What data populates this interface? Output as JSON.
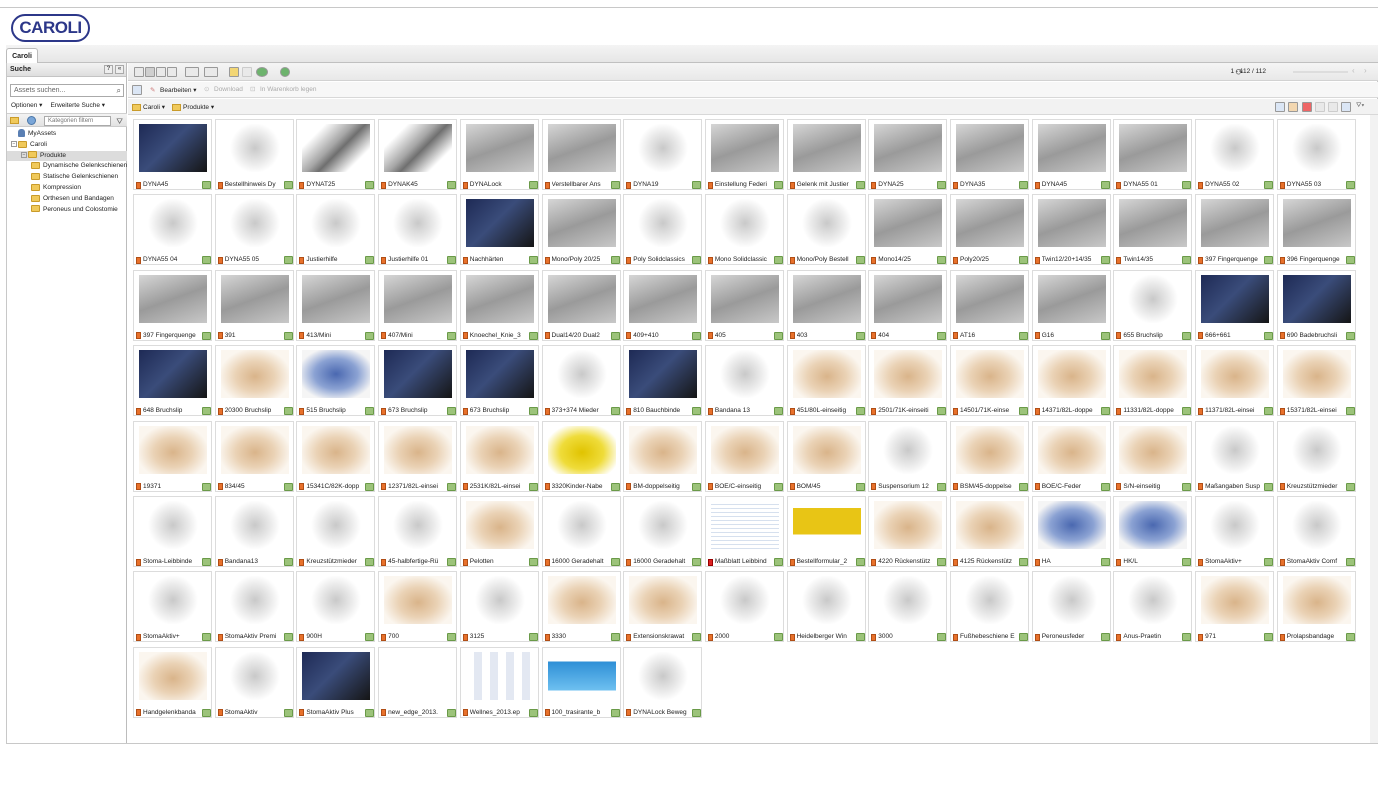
{
  "brand": {
    "logo_text": "CAROLI"
  },
  "tabs": [
    {
      "label": "Caroli"
    }
  ],
  "left_panel": {
    "title": "Suche",
    "help_btn": "?",
    "collapse_btn": "«",
    "search_placeholder": "Assets suchen...",
    "options_label": "Optionen ▾",
    "advanced_label": "Erweiterte Suche ▾",
    "category_filter_placeholder": "Kategorien filtern",
    "tree": [
      {
        "label": "MyAssets",
        "level": 0,
        "icon": "user-icon"
      },
      {
        "label": "Caroli",
        "level": 0,
        "icon": "folder-icon"
      },
      {
        "label": "Produkte",
        "level": 1,
        "icon": "folder-icon",
        "selected": true
      },
      {
        "label": "Dynamische Gelenkschienen",
        "level": 2,
        "icon": "folder-icon"
      },
      {
        "label": "Statische Gelenkschienen",
        "level": 2,
        "icon": "folder-icon"
      },
      {
        "label": "Kompression",
        "level": 2,
        "icon": "folder-icon"
      },
      {
        "label": "Orthesen und Bandagen",
        "level": 2,
        "icon": "folder-icon"
      },
      {
        "label": "Peroneus und Colostomie",
        "level": 2,
        "icon": "folder-icon"
      }
    ]
  },
  "toolbar": {
    "pagination": "1 - 112 / 112",
    "edit_label": "Bearbeiten ▾",
    "download_label": "Download",
    "basket_label": "In Warenkorb legen"
  },
  "breadcrumb": [
    {
      "label": "Caroli ▾"
    },
    {
      "label": "Produkte ▾"
    }
  ],
  "assets": [
    {
      "name": "DYNA45",
      "kind": "photo-dark"
    },
    {
      "name": "Bestellhinweis Dy",
      "kind": "photo-white"
    },
    {
      "name": "DYNAT25",
      "kind": "photo-metal"
    },
    {
      "name": "DYNAK45",
      "kind": "photo-metal"
    },
    {
      "name": "DYNALock",
      "kind": "photo-grey"
    },
    {
      "name": "Verstellbarer Ans",
      "kind": "photo-grey"
    },
    {
      "name": "DYNA19",
      "kind": "photo-white"
    },
    {
      "name": "Einstellung Federi",
      "kind": "photo-grey"
    },
    {
      "name": "Gelenk mit Justier",
      "kind": "photo-grey"
    },
    {
      "name": "DYNA25",
      "kind": "photo-grey"
    },
    {
      "name": "DYNA35",
      "kind": "photo-grey"
    },
    {
      "name": "DYNA45",
      "kind": "photo-grey"
    },
    {
      "name": "DYNA55 01",
      "kind": "photo-grey"
    },
    {
      "name": "DYNA55 02",
      "kind": "photo-white"
    },
    {
      "name": "DYNA55 03",
      "kind": "photo-white"
    },
    {
      "name": "DYNA55 04",
      "kind": "photo-white"
    },
    {
      "name": "DYNA55 05",
      "kind": "photo-white"
    },
    {
      "name": "Justierhilfe",
      "kind": "photo-white"
    },
    {
      "name": "Justierhilfe 01",
      "kind": "photo-white"
    },
    {
      "name": "Nachhärten",
      "kind": "photo-dark"
    },
    {
      "name": "Mono/Poly 20/25",
      "kind": "photo-grey"
    },
    {
      "name": "Poly Solidclassics",
      "kind": "photo-white"
    },
    {
      "name": "Mono Solidclassic",
      "kind": "photo-white"
    },
    {
      "name": "Mono/Poly Bestell",
      "kind": "photo-white"
    },
    {
      "name": "Mono14/25",
      "kind": "photo-grey"
    },
    {
      "name": "Poly20/25",
      "kind": "photo-grey"
    },
    {
      "name": "Twin12/20+14/35",
      "kind": "photo-grey"
    },
    {
      "name": "Twin14/35",
      "kind": "photo-grey"
    },
    {
      "name": "397 Fingerquenge",
      "kind": "photo-grey"
    },
    {
      "name": "396 Fingerquenge",
      "kind": "photo-grey"
    },
    {
      "name": "397 Fingerquenge",
      "kind": "photo-grey"
    },
    {
      "name": "391",
      "kind": "photo-grey"
    },
    {
      "name": "413/Mini",
      "kind": "photo-grey"
    },
    {
      "name": "407/Mini",
      "kind": "photo-grey"
    },
    {
      "name": "Knoechel_Knie_3",
      "kind": "photo-grey"
    },
    {
      "name": "Dual14/20 Dual2",
      "kind": "photo-grey"
    },
    {
      "name": "409+410",
      "kind": "photo-grey"
    },
    {
      "name": "405",
      "kind": "photo-grey"
    },
    {
      "name": "403",
      "kind": "photo-grey"
    },
    {
      "name": "404",
      "kind": "photo-grey"
    },
    {
      "name": "AT16",
      "kind": "photo-grey"
    },
    {
      "name": "G16",
      "kind": "photo-grey"
    },
    {
      "name": "655 Bruchslip",
      "kind": "photo-white"
    },
    {
      "name": "666+661",
      "kind": "photo-dark"
    },
    {
      "name": "690 Badebruchsli",
      "kind": "photo-dark"
    },
    {
      "name": "648 Bruchslip",
      "kind": "photo-dark"
    },
    {
      "name": "20300 Bruchslip",
      "kind": "photo-beige"
    },
    {
      "name": "515 Bruchslip",
      "kind": "photo-blue"
    },
    {
      "name": "673 Bruchslip",
      "kind": "photo-dark"
    },
    {
      "name": "673 Bruchslip",
      "kind": "photo-dark"
    },
    {
      "name": "373+374 Mieder",
      "kind": "photo-white"
    },
    {
      "name": "810 Bauchbinde",
      "kind": "photo-dark"
    },
    {
      "name": "Bandana 13",
      "kind": "photo-white"
    },
    {
      "name": "451/80L-einseitig",
      "kind": "photo-beige"
    },
    {
      "name": "2501/71K-einseiti",
      "kind": "photo-beige"
    },
    {
      "name": "14501/71K-einse",
      "kind": "photo-beige"
    },
    {
      "name": "14371/82L-doppe",
      "kind": "photo-beige"
    },
    {
      "name": "11331/82L-doppe",
      "kind": "photo-beige"
    },
    {
      "name": "11371/82L-einsei",
      "kind": "photo-beige"
    },
    {
      "name": "15371/82L-einsei",
      "kind": "photo-beige"
    },
    {
      "name": "19371",
      "kind": "photo-beige"
    },
    {
      "name": "834/45",
      "kind": "photo-beige"
    },
    {
      "name": "15341C/82K-dopp",
      "kind": "photo-beige"
    },
    {
      "name": "12371/82L-einsei",
      "kind": "photo-beige"
    },
    {
      "name": "2531K/82L-einsei",
      "kind": "photo-beige"
    },
    {
      "name": "3320Kinder-Nabe",
      "kind": "photo-yellow"
    },
    {
      "name": "BM-doppelseitig",
      "kind": "photo-beige"
    },
    {
      "name": "BOE/C-einseitig",
      "kind": "photo-beige"
    },
    {
      "name": "BOM/45",
      "kind": "photo-beige"
    },
    {
      "name": "Suspensorium 12",
      "kind": "photo-white"
    },
    {
      "name": "BSM/45-doppelse",
      "kind": "photo-beige"
    },
    {
      "name": "BOE/C-Feder",
      "kind": "photo-beige"
    },
    {
      "name": "S/N-einseitig",
      "kind": "photo-beige"
    },
    {
      "name": "Maßangaben Susp",
      "kind": "photo-white"
    },
    {
      "name": "Kreuzstützmieder",
      "kind": "photo-white"
    },
    {
      "name": "Stoma-Leibbinde",
      "kind": "photo-white"
    },
    {
      "name": "Bandana13",
      "kind": "photo-white"
    },
    {
      "name": "Kreuzstützmieder",
      "kind": "photo-white"
    },
    {
      "name": "45-halbfertige-Rü",
      "kind": "photo-white"
    },
    {
      "name": "Pelotten",
      "kind": "photo-beige"
    },
    {
      "name": "16000 Geradehalt",
      "kind": "photo-white"
    },
    {
      "name": "16000 Geradehalt",
      "kind": "photo-white"
    },
    {
      "name": "Maßblatt Leibbind",
      "kind": "doc",
      "pdf": true
    },
    {
      "name": "Bestellformular_2",
      "kind": "doc-yellow"
    },
    {
      "name": "4220 Rückenstütz",
      "kind": "photo-beige"
    },
    {
      "name": "4125 Rückenstütz",
      "kind": "photo-beige"
    },
    {
      "name": "HA",
      "kind": "photo-blue"
    },
    {
      "name": "HK/L",
      "kind": "photo-blue"
    },
    {
      "name": "StomaAktiv+",
      "kind": "photo-white"
    },
    {
      "name": "StomaAktiv Comf",
      "kind": "photo-white"
    },
    {
      "name": "StomaAktiv+",
      "kind": "photo-white"
    },
    {
      "name": "StomaAktiv Premi",
      "kind": "photo-white"
    },
    {
      "name": "900H",
      "kind": "photo-white"
    },
    {
      "name": "700",
      "kind": "photo-beige"
    },
    {
      "name": "3125",
      "kind": "photo-white"
    },
    {
      "name": "3330",
      "kind": "photo-beige"
    },
    {
      "name": "Extensionskrawat",
      "kind": "photo-beige"
    },
    {
      "name": "2000",
      "kind": "photo-white"
    },
    {
      "name": "Heidelberger Win",
      "kind": "photo-white"
    },
    {
      "name": "3000",
      "kind": "photo-white"
    },
    {
      "name": "Fußhebeschiene E",
      "kind": "photo-white"
    },
    {
      "name": "Peroneusfeder",
      "kind": "photo-white"
    },
    {
      "name": "Anus-Praetin",
      "kind": "photo-white"
    },
    {
      "name": "971",
      "kind": "photo-beige"
    },
    {
      "name": "Prolapsbandage",
      "kind": "photo-beige"
    },
    {
      "name": "Handgelenkbanda",
      "kind": "photo-beige"
    },
    {
      "name": "StomaAktiv",
      "kind": "photo-white"
    },
    {
      "name": "StomaAktiv Plus",
      "kind": "photo-dark"
    },
    {
      "name": "new_edge_2013.",
      "kind": "doc-newedge"
    },
    {
      "name": "Wellnes_2013.ep",
      "kind": "doc-wellness"
    },
    {
      "name": "100_trasirante_b",
      "kind": "doc-blue"
    },
    {
      "name": "DYNALock Beweg",
      "kind": "photo-white"
    }
  ]
}
